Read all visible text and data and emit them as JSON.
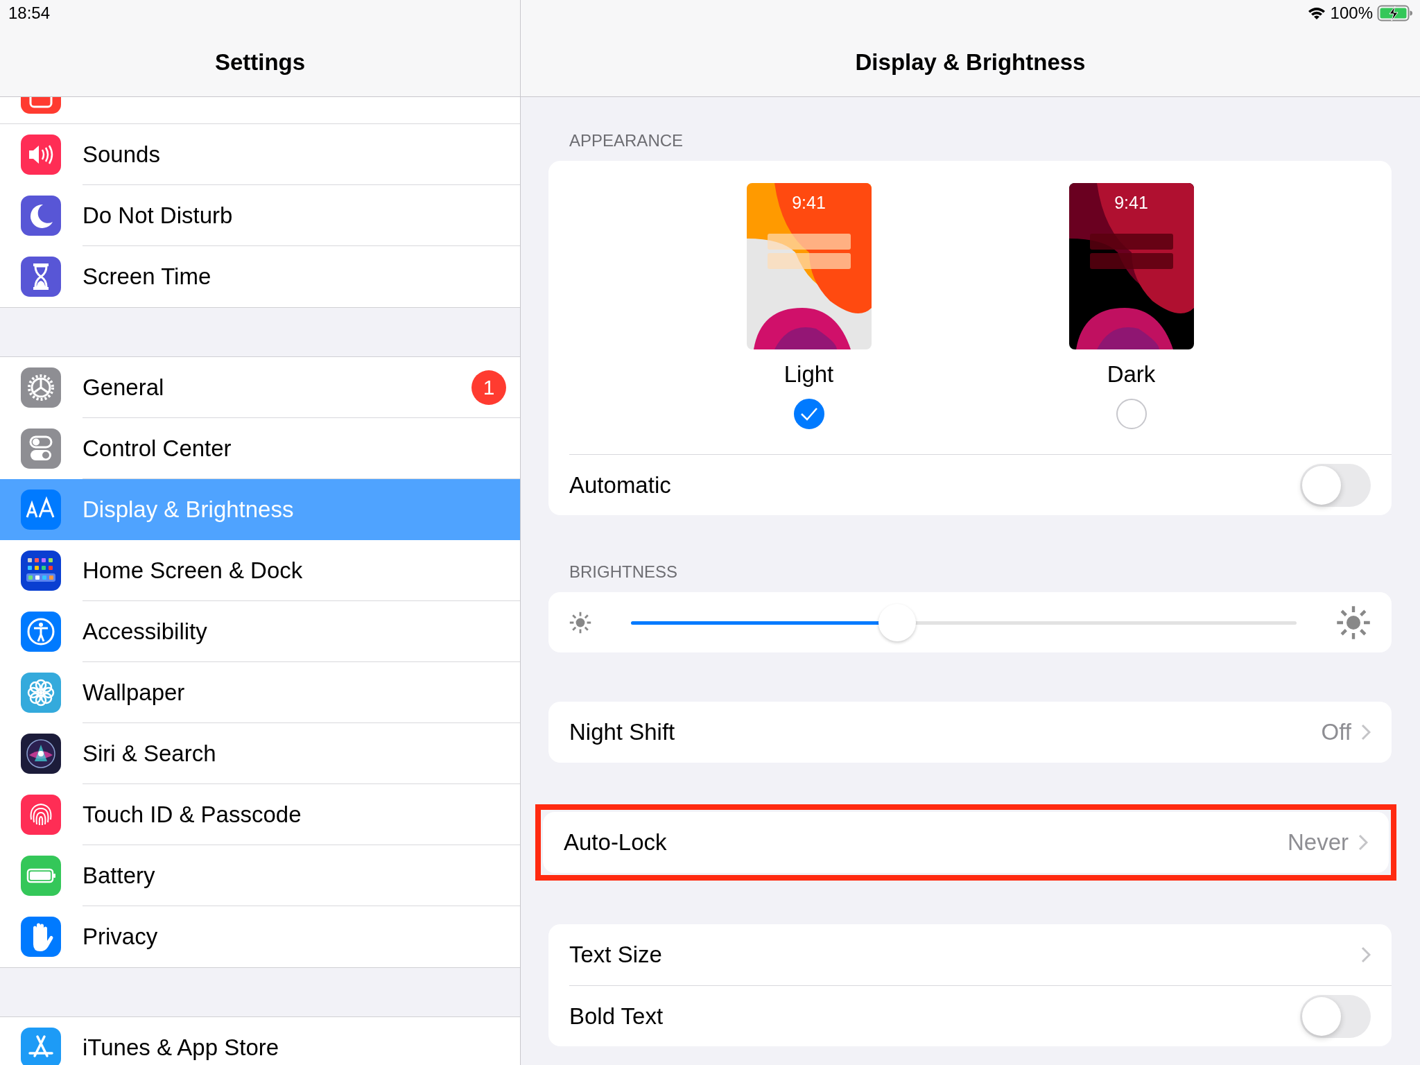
{
  "status_bar": {
    "time": "18:54",
    "battery": "100%"
  },
  "sidebar": {
    "title": "Settings",
    "groups": [
      {
        "items": [
          {
            "label": "Sounds",
            "selected": false
          },
          {
            "label": "Do Not Disturb",
            "selected": false
          },
          {
            "label": "Screen Time",
            "selected": false
          }
        ]
      },
      {
        "items": [
          {
            "label": "General",
            "selected": false,
            "badge": "1"
          },
          {
            "label": "Control Center",
            "selected": false
          },
          {
            "label": "Display & Brightness",
            "selected": true
          },
          {
            "label": "Home Screen & Dock",
            "selected": false
          },
          {
            "label": "Accessibility",
            "selected": false
          },
          {
            "label": "Wallpaper",
            "selected": false
          },
          {
            "label": "Siri & Search",
            "selected": false
          },
          {
            "label": "Touch ID & Passcode",
            "selected": false
          },
          {
            "label": "Battery",
            "selected": false
          },
          {
            "label": "Privacy",
            "selected": false
          }
        ]
      },
      {
        "items": [
          {
            "label": "iTunes & App Store",
            "selected": false
          }
        ]
      }
    ]
  },
  "detail": {
    "title": "Display & Brightness",
    "appearance": {
      "header": "APPEARANCE",
      "options": [
        {
          "kind": "light",
          "label": "Light",
          "time": "9:41",
          "selected": true
        },
        {
          "kind": "dark",
          "label": "Dark",
          "time": "9:41",
          "selected": false
        }
      ],
      "automatic": {
        "label": "Automatic",
        "on": false
      }
    },
    "brightness": {
      "header": "BRIGHTNESS",
      "level": 0.4
    },
    "groups": [
      {
        "highlighted": false,
        "rows": [
          {
            "kind": "link",
            "label": "Night Shift",
            "value": "Off"
          }
        ]
      },
      {
        "highlighted": true,
        "rows": [
          {
            "kind": "link",
            "label": "Auto-Lock",
            "value": "Never"
          }
        ]
      },
      {
        "highlighted": false,
        "rows": [
          {
            "kind": "link",
            "label": "Text Size"
          },
          {
            "kind": "switch",
            "label": "Bold Text",
            "on": false
          }
        ]
      }
    ]
  }
}
